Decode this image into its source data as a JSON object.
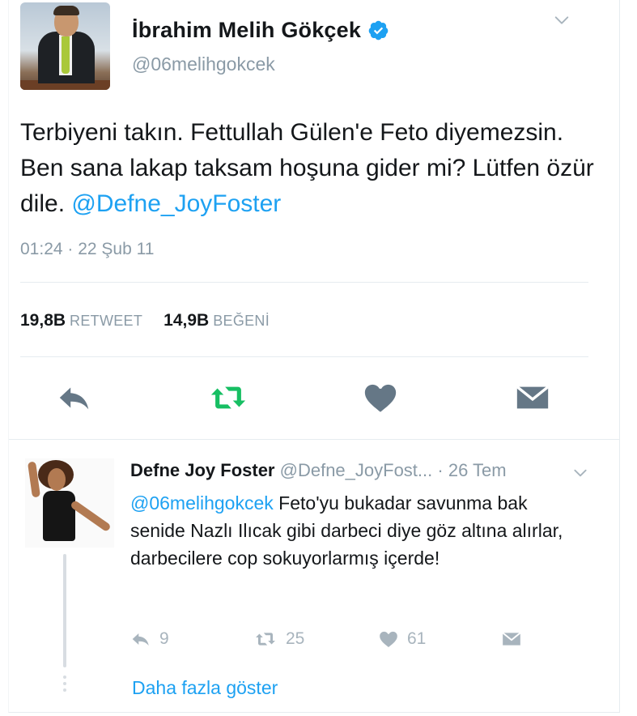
{
  "tweet": {
    "author_name": "İbrahim Melih Gökçek",
    "author_handle": "@06melihgokcek",
    "text_plain": "Terbiyeni takın. Fettullah Gülen'e Feto diyemezsin. Ben sana lakap taksam hoşuna gider mi? Lütfen özür dile.",
    "text_mention": "@Defne_JoyFoster",
    "timestamp": "01:24 · 22 Şub 11",
    "retweets_count": "19,8B",
    "retweets_label": "RETWEET",
    "likes_count": "14,9B",
    "likes_label": "BEĞENİ"
  },
  "reply": {
    "author_name": "Defne Joy Foster",
    "author_handle": "@Defne_JoyFost...",
    "date": "· 26 Tem",
    "mention": "@06melihgokcek",
    "text": "Feto'yu bukadar savunma bak senide Nazlı Ilıcak gibi darbeci diye göz altına alırlar, darbecilere cop sokuyorlarmış içerde!",
    "reply_count": "9",
    "retweet_count": "25",
    "like_count": "61"
  },
  "show_more": "Daha fazla göster",
  "colors": {
    "accent": "#1da1f2",
    "retweet_green": "#17bf63",
    "icon_gray": "#657786",
    "muted": "#8a9aa6"
  }
}
